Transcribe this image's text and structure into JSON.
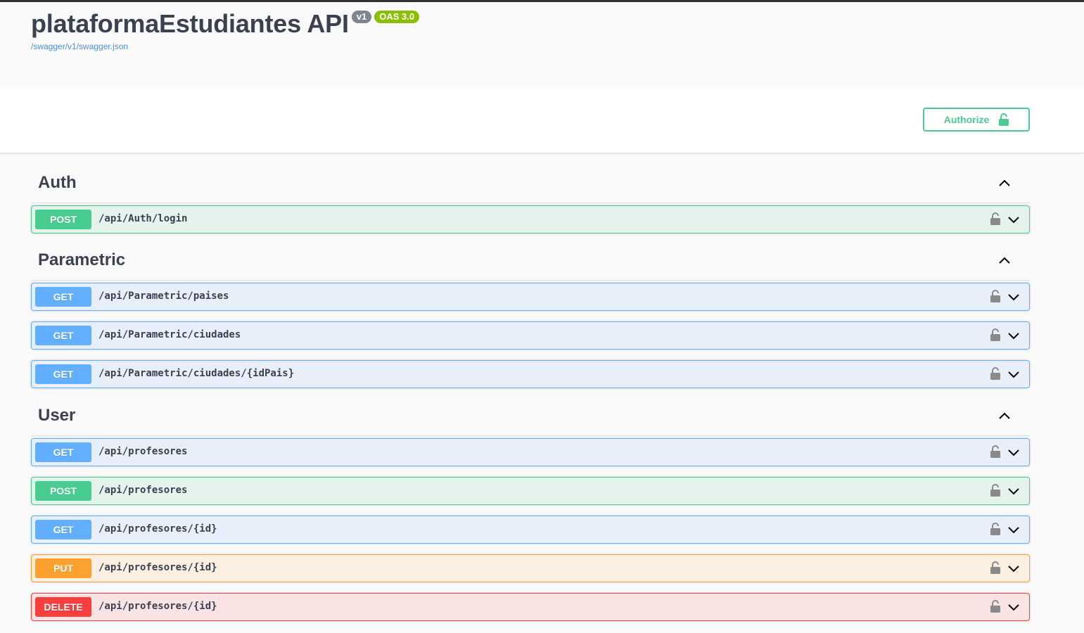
{
  "info": {
    "title": "plataformaEstudiantes API",
    "version_badge": "v1",
    "oas_badge": "OAS 3.0",
    "spec_link": "/swagger/v1/swagger.json"
  },
  "scheme": {
    "authorize_label": "Authorize",
    "icon": "unlocked-padlock-icon"
  },
  "tags": [
    {
      "name": "Auth",
      "operations": [
        {
          "method": "POST",
          "path": "/api/Auth/login"
        }
      ]
    },
    {
      "name": "Parametric",
      "operations": [
        {
          "method": "GET",
          "path": "/api/Parametric/paises"
        },
        {
          "method": "GET",
          "path": "/api/Parametric/ciudades"
        },
        {
          "method": "GET",
          "path": "/api/Parametric/ciudades/{idPais}"
        }
      ]
    },
    {
      "name": "User",
      "operations": [
        {
          "method": "GET",
          "path": "/api/profesores"
        },
        {
          "method": "POST",
          "path": "/api/profesores"
        },
        {
          "method": "GET",
          "path": "/api/profesores/{id}"
        },
        {
          "method": "PUT",
          "path": "/api/profesores/{id}"
        },
        {
          "method": "DELETE",
          "path": "/api/profesores/{id}"
        }
      ]
    }
  ],
  "colors": {
    "get": "#61affe",
    "post": "#49cc90",
    "put": "#fca130",
    "delete": "#f93e3e",
    "version_badge": "#7d8492",
    "oas_badge": "#89bf04"
  }
}
